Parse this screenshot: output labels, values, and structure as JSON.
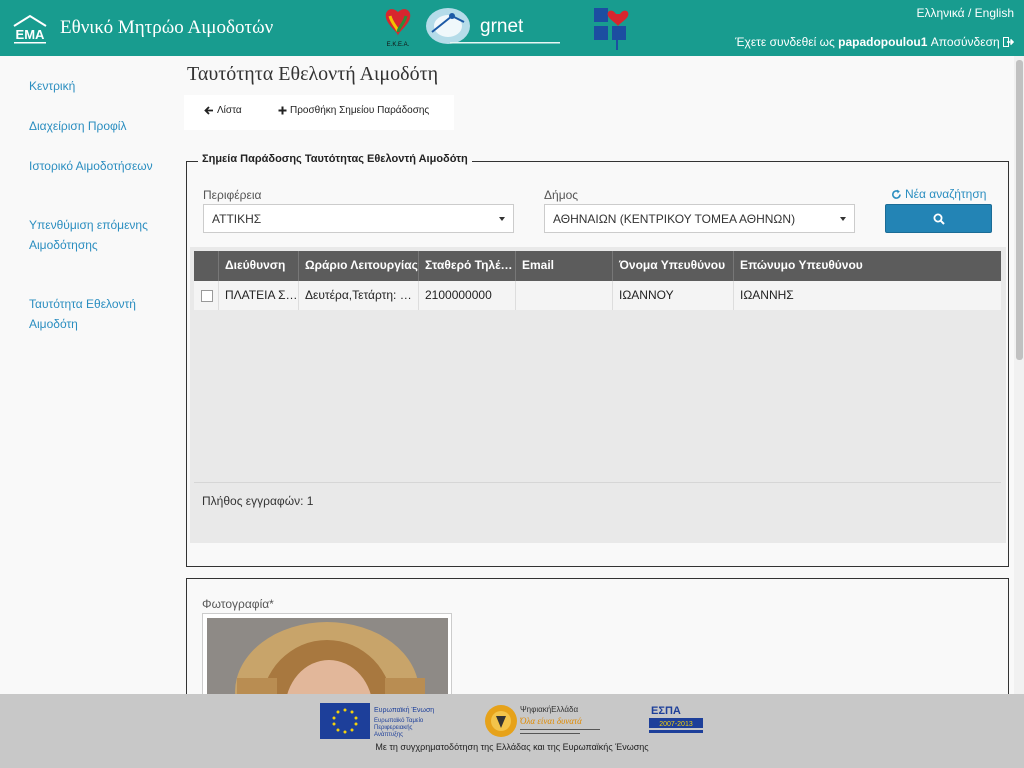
{
  "header": {
    "app_title": "Εθνικό Μητρώο Αιμοδοτών",
    "brand_abbr": "ΕΜΑ",
    "partner_logo_text": "grnet",
    "ekea_text": "Ε.Κ.Ε.Α.",
    "lang_el": "Ελληνικά",
    "lang_sep": "/",
    "lang_en": "English",
    "logged_in_prefix": "Έχετε συνδεθεί ως",
    "username": "papadopoulou1",
    "logout": "Αποσύνδεση"
  },
  "sidebar": {
    "items": [
      {
        "label": "Κεντρική"
      },
      {
        "label": "Διαχείριση Προφίλ"
      },
      {
        "label": "Ιστορικό Αιμοδοτήσεων"
      },
      {
        "label": "Υπενθύμιση επόμενης Αιμοδότησης"
      },
      {
        "label": "Ταυτότητα Εθελοντή Αιμοδότη"
      }
    ]
  },
  "main": {
    "page_title": "Ταυτότητα Εθελοντή Αιμοδότη",
    "toolbar": {
      "list_label": "Λίστα",
      "add_label": "Προσθήκη Σημείου Παράδοσης"
    },
    "points": {
      "legend": "Σημεία Παράδοσης Ταυτότητας Εθελοντή Αιμοδότη",
      "region_label": "Περιφέρεια",
      "region_value": "ΑΤΤΙΚΗΣ",
      "municipality_label": "Δήμος",
      "municipality_value": "ΑΘΗΝΑΙΩΝ (ΚΕΝΤΡΙΚΟΥ ΤΟΜΕΑ ΑΘΗΝΩΝ)",
      "new_search": "Νέα αναζήτηση",
      "columns": [
        "Διεύθυνση",
        "Ωράριο Λειτουργίας",
        "Σταθερό Τηλέ…",
        "Email",
        "Όνομα Υπευθύνου",
        "Επώνυμο Υπευθύνου"
      ],
      "rows": [
        [
          "ΠΛΑΤΕΙΑ Σ…",
          "Δευτέρα,Τετάρτη: …",
          "2100000000",
          "",
          "ΙΩΑΝΝΟΥ",
          "ΙΩΑΝΝΗΣ"
        ]
      ],
      "record_count_label": "Πλήθος εγγραφών: 1"
    },
    "photo": {
      "label": "Φωτογραφία*"
    }
  },
  "footer": {
    "funding_text": "Με τη συγχρηματοδότηση της Ελλάδας και της Ευρωπαϊκής Ένωσης",
    "eu_line1": "Ευρωπαϊκή Ένωση",
    "eu_line2": "Ευρωπαϊκό Ταμείο",
    "eu_line3": "Περιφερειακής",
    "eu_line4": "Ανάπτυξης",
    "ds_title": "ΨηφιακήΕλλάδα",
    "ds_slogan": "Όλα είναι δυνατά",
    "espa": "ΕΣΠΑ",
    "espa_years": "2007-2013"
  },
  "colors": {
    "header_bg": "#189c8f",
    "link": "#2b8ec0",
    "search_button": "#2384b5",
    "grid_header": "#5c5c5c",
    "footer_bg": "#c8c8c8"
  }
}
